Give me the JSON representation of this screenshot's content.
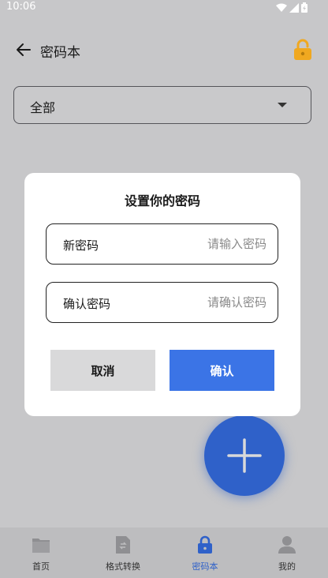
{
  "status_bar": {
    "time": "10:06"
  },
  "app_bar": {
    "title": "密码本"
  },
  "filter": {
    "selected": "全部"
  },
  "dialog": {
    "title": "设置你的密码",
    "new_password": {
      "label": "新密码",
      "placeholder": "请输入密码"
    },
    "confirm_password": {
      "label": "确认密码",
      "placeholder": "请确认密码"
    },
    "cancel_label": "取消",
    "confirm_label": "确认"
  },
  "bottom_nav": {
    "items": [
      {
        "label": "首页",
        "icon": "folder-icon"
      },
      {
        "label": "格式转换",
        "icon": "file-convert-icon"
      },
      {
        "label": "密码本",
        "icon": "lock-icon",
        "active": true
      },
      {
        "label": "我的",
        "icon": "person-icon"
      }
    ]
  },
  "colors": {
    "accent": "#3b74e6",
    "fab": "#2f61c9",
    "lock": "#f0a820",
    "backdrop": "#c7c7c9"
  }
}
